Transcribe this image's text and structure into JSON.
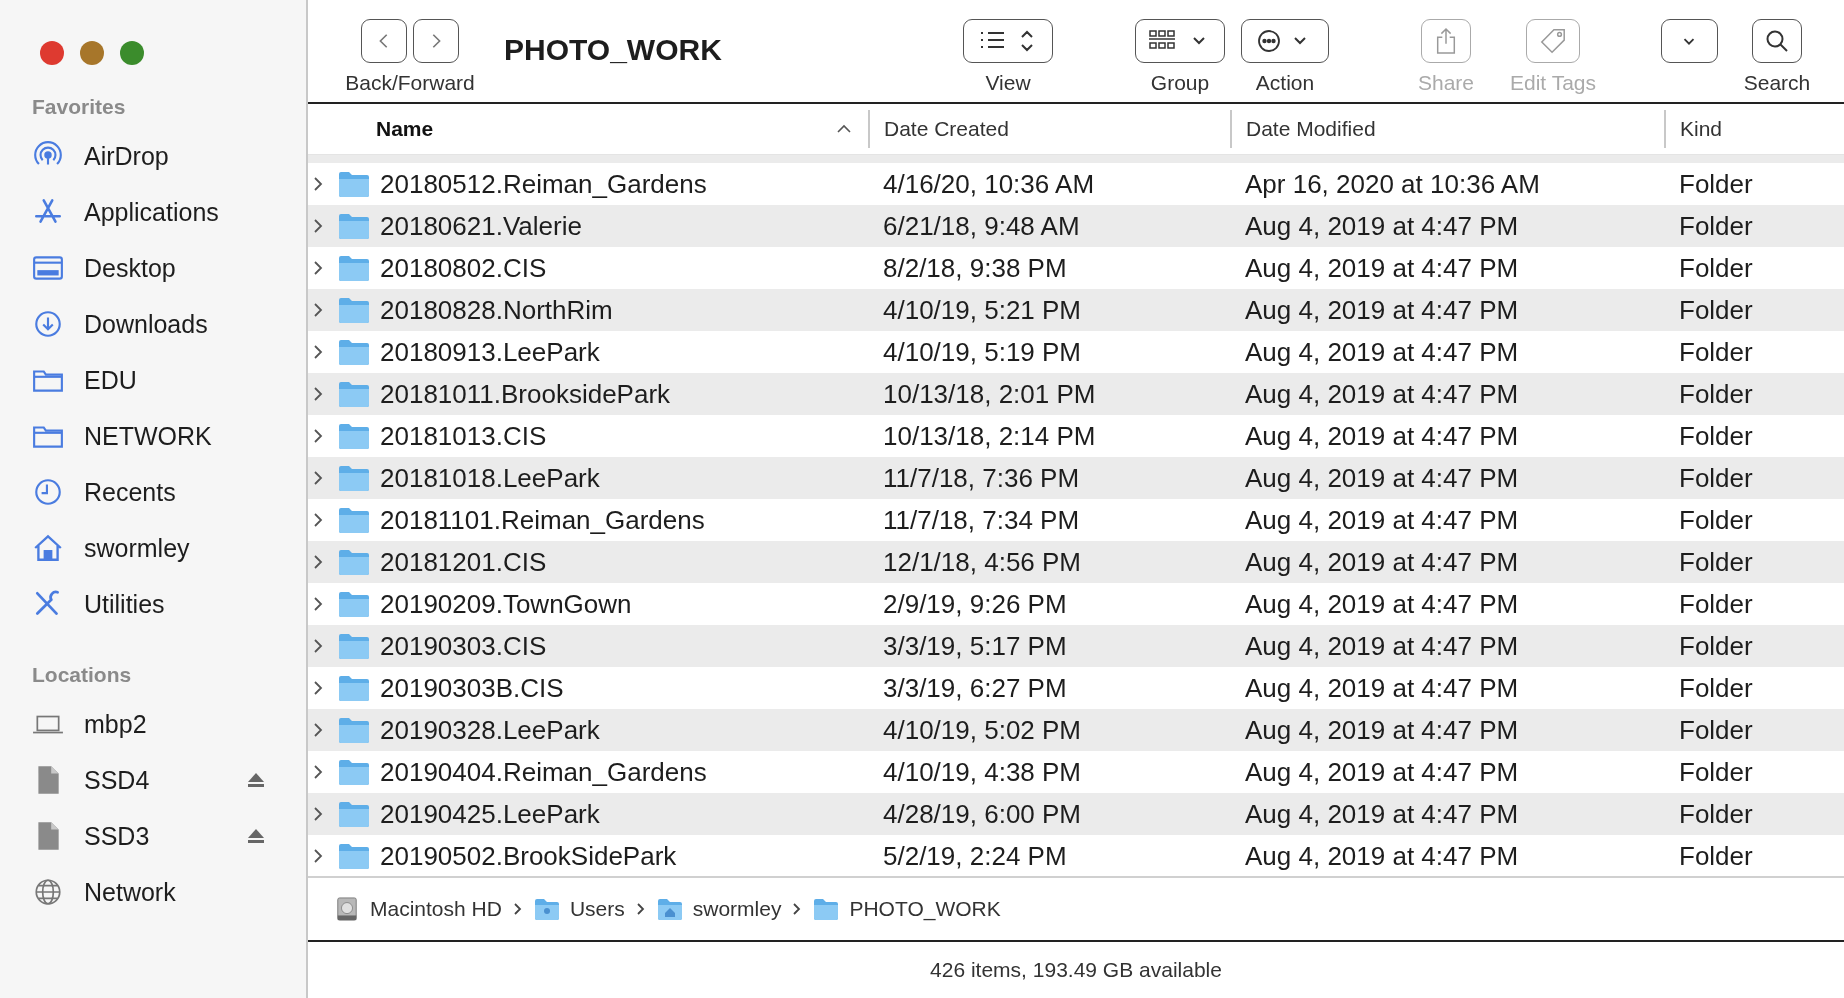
{
  "window": {
    "title": "PHOTO_WORK"
  },
  "sidebar": {
    "sections": [
      {
        "heading": "Favorites",
        "items": [
          {
            "label": "AirDrop",
            "kind": "airdrop",
            "ejectable": false
          },
          {
            "label": "Applications",
            "kind": "apps",
            "ejectable": false
          },
          {
            "label": "Desktop",
            "kind": "desktop",
            "ejectable": false
          },
          {
            "label": "Downloads",
            "kind": "download",
            "ejectable": false
          },
          {
            "label": "EDU",
            "kind": "folder",
            "ejectable": false
          },
          {
            "label": "NETWORK",
            "kind": "folder",
            "ejectable": false
          },
          {
            "label": "Recents",
            "kind": "clock",
            "ejectable": false
          },
          {
            "label": "swormley",
            "kind": "home",
            "ejectable": false
          },
          {
            "label": "Utilities",
            "kind": "tools",
            "ejectable": false
          }
        ]
      },
      {
        "heading": "Locations",
        "items": [
          {
            "label": "mbp2",
            "kind": "laptop",
            "ejectable": false
          },
          {
            "label": "SSD4",
            "kind": "drive",
            "ejectable": true
          },
          {
            "label": "SSD3",
            "kind": "drive",
            "ejectable": true
          },
          {
            "label": "Network",
            "kind": "globe",
            "ejectable": false
          }
        ]
      }
    ]
  },
  "toolbar": [
    {
      "kind": "nav",
      "label": "Back/Forward",
      "disabled": false
    },
    {
      "kind": "view",
      "label": "View",
      "disabled": false
    },
    {
      "kind": "group",
      "label": "Group",
      "disabled": false
    },
    {
      "kind": "action",
      "label": "Action",
      "disabled": false
    },
    {
      "kind": "share",
      "label": "Share",
      "disabled": true
    },
    {
      "kind": "tags",
      "label": "Edit Tags",
      "disabled": true
    },
    {
      "kind": "dropdown",
      "disabled": false
    },
    {
      "kind": "search",
      "label": "Search",
      "disabled": false
    }
  ],
  "table": {
    "columns": [
      {
        "label": "Name",
        "sorted": true
      },
      {
        "label": "Date Created",
        "sorted": false
      },
      {
        "label": "Date Modified",
        "sorted": false
      },
      {
        "label": "Kind",
        "sorted": false
      }
    ],
    "rows": [
      {
        "name": "20180512.Reiman_Gardens",
        "created": "4/16/20, 10:36 AM",
        "modified": "Apr 16, 2020 at 10:36 AM",
        "kind": "Folder",
        "expanded": false
      },
      {
        "name": "20180621.Valerie",
        "created": "6/21/18, 9:48 AM",
        "modified": "Aug 4, 2019 at 4:47 PM",
        "kind": "Folder",
        "expanded": false
      },
      {
        "name": "20180802.CIS",
        "created": "8/2/18, 9:38 PM",
        "modified": "Aug 4, 2019 at 4:47 PM",
        "kind": "Folder",
        "expanded": false
      },
      {
        "name": "20180828.NorthRim",
        "created": "4/10/19, 5:21 PM",
        "modified": "Aug 4, 2019 at 4:47 PM",
        "kind": "Folder",
        "expanded": false
      },
      {
        "name": "20180913.LeePark",
        "created": "4/10/19, 5:19 PM",
        "modified": "Aug 4, 2019 at 4:47 PM",
        "kind": "Folder",
        "expanded": false
      },
      {
        "name": "20181011.BrooksidePark",
        "created": "10/13/18, 2:01 PM",
        "modified": "Aug 4, 2019 at 4:47 PM",
        "kind": "Folder",
        "expanded": false
      },
      {
        "name": "20181013.CIS",
        "created": "10/13/18, 2:14 PM",
        "modified": "Aug 4, 2019 at 4:47 PM",
        "kind": "Folder",
        "expanded": false
      },
      {
        "name": "20181018.LeePark",
        "created": "11/7/18, 7:36 PM",
        "modified": "Aug 4, 2019 at 4:47 PM",
        "kind": "Folder",
        "expanded": false
      },
      {
        "name": "20181101.Reiman_Gardens",
        "created": "11/7/18, 7:34 PM",
        "modified": "Aug 4, 2019 at 4:47 PM",
        "kind": "Folder",
        "expanded": false
      },
      {
        "name": "20181201.CIS",
        "created": "12/1/18, 4:56 PM",
        "modified": "Aug 4, 2019 at 4:47 PM",
        "kind": "Folder",
        "expanded": false
      },
      {
        "name": "20190209.TownGown",
        "created": "2/9/19, 9:26 PM",
        "modified": "Aug 4, 2019 at 4:47 PM",
        "kind": "Folder",
        "expanded": false
      },
      {
        "name": "20190303.CIS",
        "created": "3/3/19, 5:17 PM",
        "modified": "Aug 4, 2019 at 4:47 PM",
        "kind": "Folder",
        "expanded": false
      },
      {
        "name": "20190303B.CIS",
        "created": "3/3/19, 6:27 PM",
        "modified": "Aug 4, 2019 at 4:47 PM",
        "kind": "Folder",
        "expanded": false
      },
      {
        "name": "20190328.LeePark",
        "created": "4/10/19, 5:02 PM",
        "modified": "Aug 4, 2019 at 4:47 PM",
        "kind": "Folder",
        "expanded": false
      },
      {
        "name": "20190404.Reiman_Gardens",
        "created": "4/10/19, 4:38 PM",
        "modified": "Aug 4, 2019 at 4:47 PM",
        "kind": "Folder",
        "expanded": false
      },
      {
        "name": "20190425.LeePark",
        "created": "4/28/19, 6:00 PM",
        "modified": "Aug 4, 2019 at 4:47 PM",
        "kind": "Folder",
        "expanded": false
      },
      {
        "name": "20190502.BrookSidePark",
        "created": "5/2/19, 2:24 PM",
        "modified": "Aug 4, 2019 at 4:47 PM",
        "kind": "Folder",
        "expanded": false
      }
    ]
  },
  "path_bar": [
    {
      "label": "Macintosh HD",
      "kind": "disk"
    },
    {
      "label": "Users",
      "kind": "users-folder"
    },
    {
      "label": "swormley",
      "kind": "home-folder"
    },
    {
      "label": "PHOTO_WORK",
      "kind": "folder"
    }
  ],
  "status_bar": "426 items, 193.49 GB available"
}
